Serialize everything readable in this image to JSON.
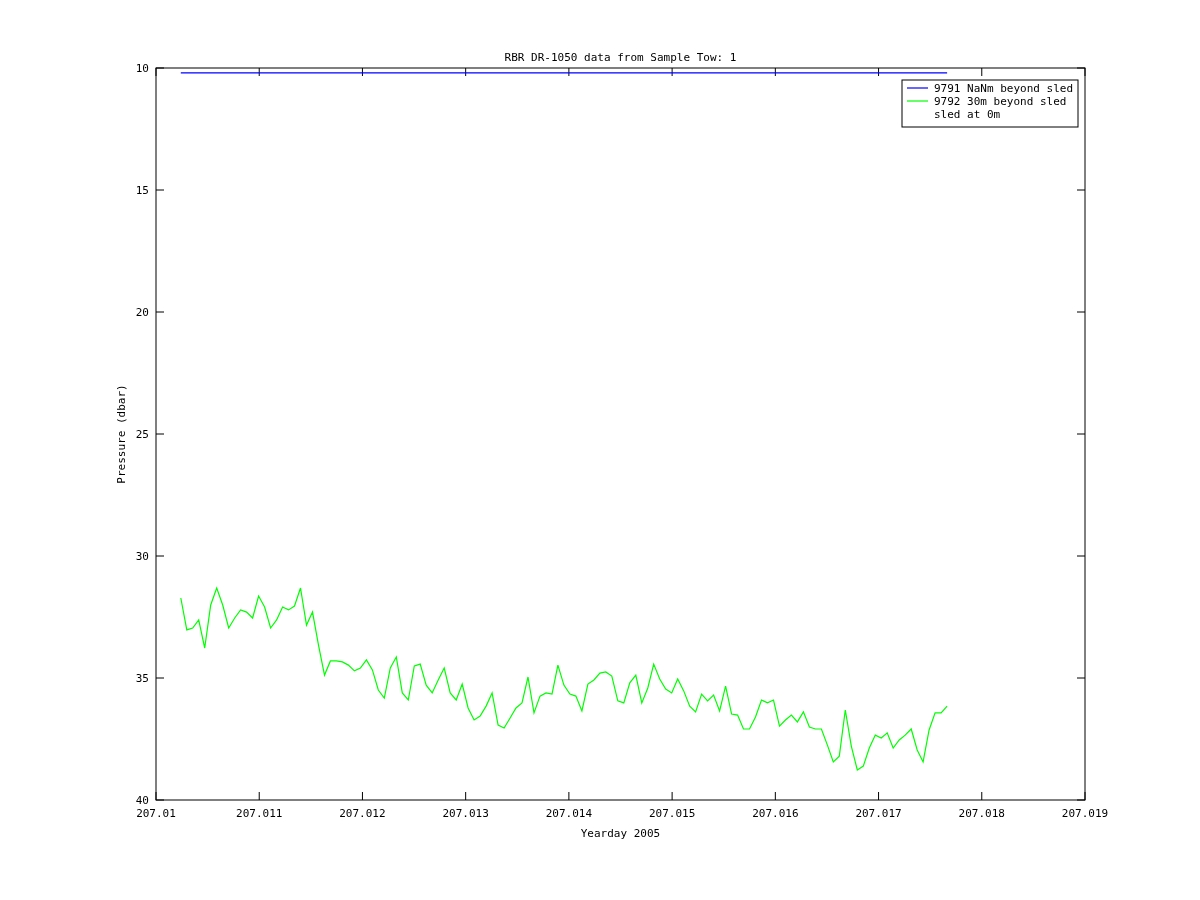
{
  "chart": {
    "chart_data": {
      "type": "line",
      "title": "RBR DR-1050 data from Sample Tow: 1",
      "xlabel": "Yearday 2005",
      "ylabel": "Pressure (dbar)",
      "legend": true,
      "xlim": [
        207.01,
        207.019
      ],
      "ylim": [
        40,
        10
      ],
      "xticks": [
        {
          "value": 207.01,
          "label": "207.01"
        },
        207.011,
        207.012,
        207.013,
        207.014,
        207.015,
        207.016,
        207.017,
        207.018,
        207.019
      ],
      "yticks": [
        10,
        15,
        20,
        25,
        30,
        35,
        40
      ],
      "x": [
        207.01024,
        207.010298,
        207.010356,
        207.010414,
        207.010472,
        207.01053,
        207.010588,
        207.010646,
        207.010704,
        207.010762,
        207.01082,
        207.010878,
        207.010936,
        207.010994,
        207.011052,
        207.01111,
        207.011168,
        207.011226,
        207.011284,
        207.011342,
        207.0114,
        207.011458,
        207.011516,
        207.011574,
        207.011632,
        207.01169,
        207.011748,
        207.011806,
        207.011864,
        207.011922,
        207.01198,
        207.012038,
        207.012096,
        207.012154,
        207.012212,
        207.01227,
        207.012328,
        207.012386,
        207.012444,
        207.012502,
        207.01256,
        207.012618,
        207.012676,
        207.012734,
        207.012792,
        207.01285,
        207.012908,
        207.012966,
        207.013024,
        207.013082,
        207.01314,
        207.013198,
        207.013256,
        207.013314,
        207.013372,
        207.01343,
        207.013488,
        207.013546,
        207.013604,
        207.013662,
        207.01372,
        207.013778,
        207.013836,
        207.013894,
        207.013952,
        207.01401,
        207.014068,
        207.014126,
        207.014184,
        207.014242,
        207.0143,
        207.014358,
        207.014416,
        207.014474,
        207.014532,
        207.01459,
        207.014648,
        207.014706,
        207.014764,
        207.014822,
        207.01488,
        207.014938,
        207.014996,
        207.015054,
        207.015112,
        207.01517,
        207.015228,
        207.015286,
        207.015344,
        207.015402,
        207.01546,
        207.015518,
        207.015576,
        207.015634,
        207.015692,
        207.01575,
        207.015808,
        207.015866,
        207.015924,
        207.015982,
        207.01604,
        207.016098,
        207.016156,
        207.016214,
        207.016272,
        207.01633,
        207.016388,
        207.016446,
        207.016504,
        207.016562,
        207.01662,
        207.016678,
        207.016736,
        207.016794,
        207.016852,
        207.01691,
        207.016968,
        207.017026,
        207.017084,
        207.017142,
        207.0172,
        207.017258,
        207.017316,
        207.017374,
        207.017432,
        207.01749,
        207.017548,
        207.017606,
        207.017664
      ],
      "series": [
        {
          "name": "9791 NaNm beyond sled",
          "color": "#0000ff",
          "values": [
            10.2,
            10.2,
            10.2,
            10.2,
            10.2,
            10.2,
            10.2,
            10.2,
            10.2,
            10.2,
            10.2,
            10.2,
            10.2,
            10.2,
            10.2,
            10.2,
            10.2,
            10.2,
            10.2,
            10.2,
            10.2,
            10.2,
            10.2,
            10.2,
            10.2,
            10.2,
            10.2,
            10.2,
            10.2,
            10.2,
            10.2,
            10.2,
            10.2,
            10.2,
            10.2,
            10.2,
            10.2,
            10.2,
            10.2,
            10.2,
            10.2,
            10.2,
            10.2,
            10.2,
            10.2,
            10.2,
            10.2,
            10.2,
            10.2,
            10.2,
            10.2,
            10.2,
            10.2,
            10.2,
            10.2,
            10.2,
            10.2,
            10.2,
            10.2,
            10.2,
            10.2,
            10.2,
            10.2,
            10.2,
            10.2,
            10.2,
            10.2,
            10.2,
            10.2,
            10.2,
            10.2,
            10.2,
            10.2,
            10.2,
            10.2,
            10.2,
            10.2,
            10.2,
            10.2,
            10.2,
            10.2,
            10.2,
            10.2,
            10.2,
            10.2,
            10.2,
            10.2,
            10.2,
            10.2,
            10.2,
            10.2,
            10.2,
            10.2,
            10.2,
            10.2,
            10.2,
            10.2,
            10.2,
            10.2,
            10.2,
            10.2,
            10.2,
            10.2,
            10.2,
            10.2,
            10.2,
            10.2,
            10.2,
            10.2,
            10.2,
            10.2,
            10.2,
            10.2,
            10.2,
            10.2,
            10.2,
            10.2,
            10.2,
            10.2,
            10.2,
            10.2,
            10.2,
            10.2,
            10.2,
            10.2,
            10.2,
            10.2,
            10.2,
            10.2
          ]
        },
        {
          "name": "9792 30m beyond sled",
          "color": "#00ff00",
          "values": [
            31.72,
            33.03,
            32.95,
            32.62,
            33.77,
            32.01,
            31.31,
            32.01,
            32.95,
            32.54,
            32.21,
            32.3,
            32.54,
            31.64,
            32.09,
            32.95,
            32.62,
            32.09,
            32.21,
            32.05,
            31.31,
            32.83,
            32.3,
            33.65,
            34.88,
            34.3,
            34.3,
            34.34,
            34.47,
            34.71,
            34.59,
            34.26,
            34.67,
            35.49,
            35.82,
            34.59,
            34.14,
            35.61,
            35.9,
            34.51,
            34.43,
            35.29,
            35.61,
            35.08,
            34.59,
            35.61,
            35.9,
            35.25,
            36.23,
            36.72,
            36.56,
            36.15,
            35.61,
            36.93,
            37.05,
            36.64,
            36.23,
            36.02,
            34.96,
            36.43,
            35.74,
            35.61,
            35.66,
            34.47,
            35.29,
            35.66,
            35.74,
            36.35,
            35.25,
            35.08,
            34.8,
            34.75,
            34.92,
            35.94,
            36.02,
            35.2,
            34.88,
            36.02,
            35.41,
            34.43,
            35.04,
            35.45,
            35.61,
            35.04,
            35.53,
            36.15,
            36.39,
            35.66,
            35.94,
            35.7,
            36.35,
            35.33,
            36.48,
            36.52,
            37.09,
            37.09,
            36.6,
            35.9,
            36.02,
            35.9,
            36.97,
            36.72,
            36.52,
            36.8,
            36.39,
            37.01,
            37.09,
            37.09,
            37.75,
            38.44,
            38.2,
            36.31,
            37.79,
            38.77,
            38.61,
            37.87,
            37.34,
            37.46,
            37.25,
            37.87,
            37.54,
            37.34,
            37.09,
            37.95,
            38.44,
            37.13,
            36.43,
            36.43,
            36.15
          ]
        }
      ]
    },
    "legend_extra": [
      {
        "label": "sled at 0m"
      }
    ]
  }
}
